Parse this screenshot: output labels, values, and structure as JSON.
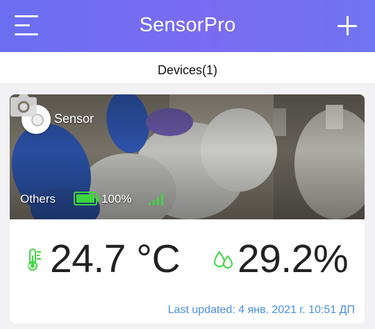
{
  "header": {
    "title": "SensorPro",
    "menu_icon": "menu-icon",
    "add_icon": "plus-icon"
  },
  "tabs": {
    "devices_label": "Devices(1)"
  },
  "device_card": {
    "name": "Sensor",
    "group": "Others",
    "battery_level_percent": 100,
    "battery_text": "100%",
    "signal_bars": 4,
    "temperature": "24.7 °C",
    "humidity": "29.2%",
    "last_updated": "Last updated: 4 янв. 2021 г. 10:51 ДП",
    "camera_icon": "camera-icon"
  },
  "colors": {
    "header_gradient_start": "#6a6ef0",
    "header_gradient_end": "#7b6cf2",
    "status_green": "#3ed63e",
    "link_blue": "#4a8ee0"
  }
}
